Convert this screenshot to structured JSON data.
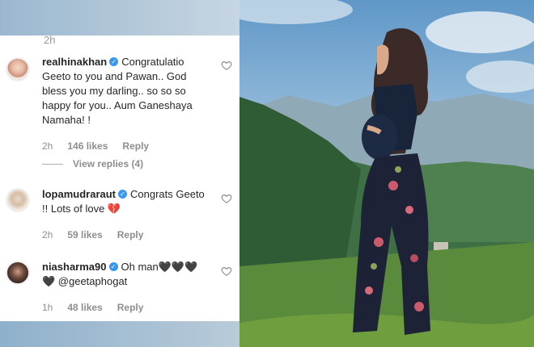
{
  "comments_top_timestamp": "2h",
  "comments": [
    {
      "username": "realhinakhan",
      "text": "Congratulatio Geeto to you and Pawan.. God bless you my darling.. so so so happy for you.. Aum Ganeshaya Namaha! !",
      "time": "2h",
      "likes": "146 likes",
      "reply": "Reply",
      "view_replies": "View replies (4)"
    },
    {
      "username": "lopamudraraut",
      "text": "Congrats Geeto !! Lots of love 💔",
      "time": "2h",
      "likes": "59 likes",
      "reply": "Reply"
    },
    {
      "username": "niasharma90",
      "text": "Oh man🖤🖤🖤🖤 @geetaphogat",
      "time": "1h",
      "likes": "48 likes",
      "reply": "Reply"
    }
  ],
  "colors": {
    "verified_badge": "#3897f0",
    "meta_text": "#8e8e8e",
    "comment_text": "#262626"
  },
  "icons": [
    "verified-badge-icon",
    "heart-outline-icon",
    "avatar-image"
  ]
}
